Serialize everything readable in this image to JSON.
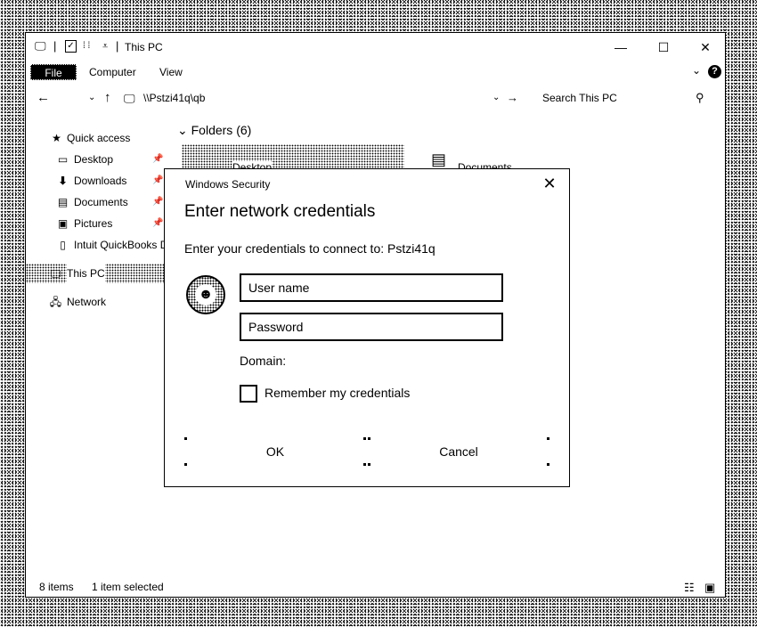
{
  "window": {
    "title": "This PC",
    "controls": {
      "minimize": "—",
      "maximize": "☐",
      "close": "✕"
    }
  },
  "ribbon": {
    "file": "File",
    "tabs": [
      "Computer",
      "View"
    ],
    "help": "?"
  },
  "address_bar": {
    "path": "\\\\Pstzi41q\\qb",
    "search_placeholder": "Search This PC"
  },
  "sidebar": {
    "items": [
      {
        "label": "Quick access",
        "icon": "star-icon"
      },
      {
        "label": "Desktop",
        "icon": "desktop-icon",
        "pinned": true
      },
      {
        "label": "Downloads",
        "icon": "download-arrow-icon",
        "pinned": true
      },
      {
        "label": "Documents",
        "icon": "document-icon",
        "pinned": true
      },
      {
        "label": "Pictures",
        "icon": "picture-icon",
        "pinned": true
      },
      {
        "label": "Intuit QuickBooks D",
        "icon": "file-icon"
      },
      {
        "label": "This PC",
        "icon": "computer-icon",
        "selected": true
      },
      {
        "label": "Network",
        "icon": "network-icon"
      }
    ]
  },
  "content": {
    "group_header": "Folders (6)",
    "tiles": [
      "Desktop",
      "Documents"
    ]
  },
  "status_bar": {
    "item_count": "8 items",
    "selection": "1 item selected"
  },
  "dialog": {
    "caption": "Windows Security",
    "heading": "Enter network credentials",
    "prompt": "Enter your credentials to connect to: Pstzi41q",
    "username_placeholder": "User name",
    "password_placeholder": "Password",
    "domain_label": "Domain:",
    "remember_label": "Remember my credentials",
    "remember_checked": false,
    "ok_label": "OK",
    "cancel_label": "Cancel"
  }
}
